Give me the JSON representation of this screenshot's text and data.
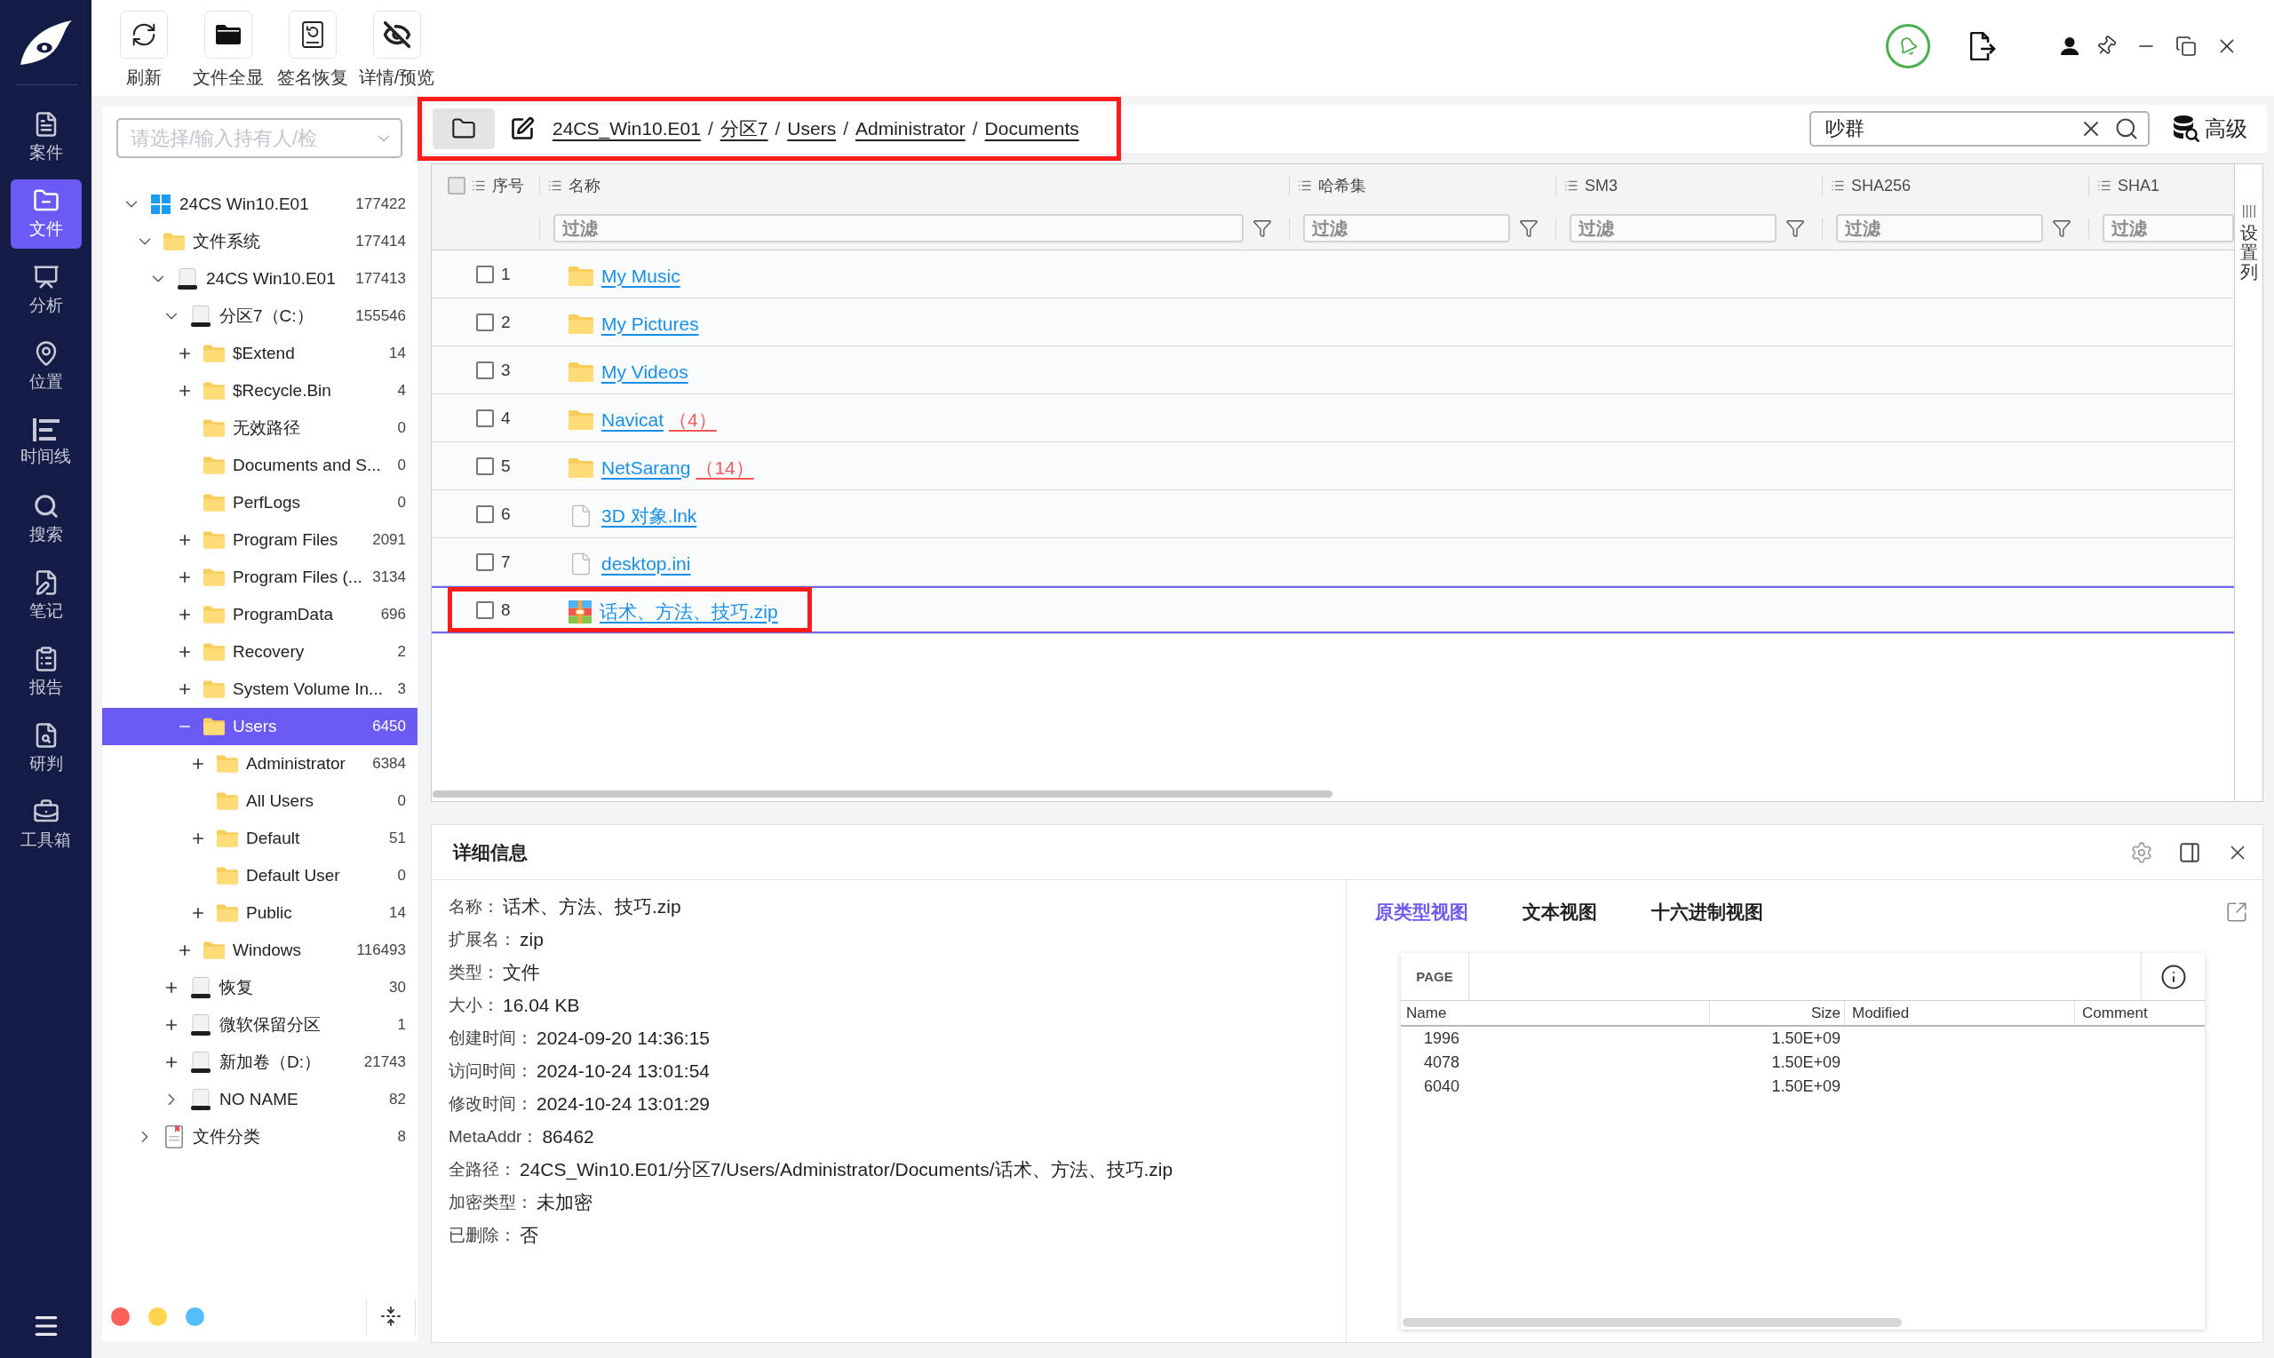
{
  "nav": {
    "items": [
      {
        "label": "案件",
        "selected": false
      },
      {
        "label": "文件",
        "selected": true
      },
      {
        "label": "分析",
        "selected": false
      },
      {
        "label": "位置",
        "selected": false
      },
      {
        "label": "时间线",
        "selected": false
      },
      {
        "label": "搜索",
        "selected": false
      },
      {
        "label": "笔记",
        "selected": false
      },
      {
        "label": "报告",
        "selected": false
      },
      {
        "label": "研判",
        "selected": false
      },
      {
        "label": "工具箱",
        "selected": false
      }
    ]
  },
  "toolbar": {
    "buttons": [
      {
        "label": "刷新"
      },
      {
        "label": "文件全显"
      },
      {
        "label": "签名恢复"
      },
      {
        "label": "详情/预览"
      }
    ]
  },
  "tree": {
    "owner_select": {
      "placeholder": "请选择/输入持有人/检"
    },
    "nodes": [
      {
        "label": "24CS Win10.E01",
        "count": "177422",
        "kind": "image",
        "toggle": {
          "kind": "chevron",
          "expanded": true
        },
        "selected": false,
        "children": [
          {
            "label": "文件系统",
            "count": "177414",
            "kind": "folder",
            "toggle": {
              "kind": "chevron",
              "expanded": true
            },
            "selected": false,
            "children": [
              {
                "label": "24CS Win10.E01",
                "count": "177413",
                "kind": "drive",
                "toggle": {
                  "kind": "chevron",
                  "expanded": true
                },
                "selected": false,
                "children": [
                  {
                    "label": "分区7（C:）",
                    "count": "155546",
                    "kind": "drive",
                    "toggle": {
                      "kind": "chevron",
                      "expanded": true
                    },
                    "selected": false,
                    "children": [
                      {
                        "label": "$Extend",
                        "count": "14",
                        "kind": "folder",
                        "toggle": {
                          "kind": "plus",
                          "expanded": false
                        },
                        "selected": false
                      },
                      {
                        "label": "$Recycle.Bin",
                        "count": "4",
                        "kind": "folder",
                        "toggle": {
                          "kind": "plus",
                          "expanded": false
                        },
                        "selected": false
                      },
                      {
                        "label": "无效路径",
                        "count": "0",
                        "kind": "folder",
                        "selected": false
                      },
                      {
                        "label": "Documents and S...",
                        "count": "0",
                        "kind": "folder",
                        "selected": false
                      },
                      {
                        "label": "PerfLogs",
                        "count": "0",
                        "kind": "folder",
                        "selected": false
                      },
                      {
                        "label": "Program Files",
                        "count": "2091",
                        "kind": "folder",
                        "toggle": {
                          "kind": "plus",
                          "expanded": false
                        },
                        "selected": false
                      },
                      {
                        "label": "Program Files (...",
                        "count": "3134",
                        "kind": "folder",
                        "toggle": {
                          "kind": "plus",
                          "expanded": false
                        },
                        "selected": false
                      },
                      {
                        "label": "ProgramData",
                        "count": "696",
                        "kind": "folder",
                        "toggle": {
                          "kind": "plus",
                          "expanded": false
                        },
                        "selected": false
                      },
                      {
                        "label": "Recovery",
                        "count": "2",
                        "kind": "folder",
                        "toggle": {
                          "kind": "plus",
                          "expanded": false
                        },
                        "selected": false
                      },
                      {
                        "label": "System Volume In...",
                        "count": "3",
                        "kind": "folder",
                        "toggle": {
                          "kind": "plus",
                          "expanded": false
                        },
                        "selected": false
                      },
                      {
                        "label": "Users",
                        "count": "6450",
                        "kind": "folder",
                        "toggle": {
                          "kind": "plus",
                          "expanded": true
                        },
                        "selected": true,
                        "children": [
                          {
                            "label": "Administrator",
                            "count": "6384",
                            "kind": "folder",
                            "toggle": {
                              "kind": "plus",
                              "expanded": false
                            },
                            "selected": false
                          },
                          {
                            "label": "All Users",
                            "count": "0",
                            "kind": "folder",
                            "selected": false
                          },
                          {
                            "label": "Default",
                            "count": "51",
                            "kind": "folder",
                            "toggle": {
                              "kind": "plus",
                              "expanded": false
                            },
                            "selected": false
                          },
                          {
                            "label": "Default User",
                            "count": "0",
                            "kind": "folder",
                            "selected": false
                          },
                          {
                            "label": "Public",
                            "count": "14",
                            "kind": "folder",
                            "toggle": {
                              "kind": "plus",
                              "expanded": false
                            },
                            "selected": false
                          }
                        ]
                      },
                      {
                        "label": "Windows",
                        "count": "116493",
                        "kind": "folder",
                        "toggle": {
                          "kind": "plus",
                          "expanded": false
                        },
                        "selected": false
                      }
                    ]
                  },
                  {
                    "label": "恢复",
                    "count": "30",
                    "kind": "drive",
                    "toggle": {
                      "kind": "plus",
                      "expanded": false
                    },
                    "selected": false
                  },
                  {
                    "label": "微软保留分区",
                    "count": "1",
                    "kind": "drive",
                    "toggle": {
                      "kind": "plus",
                      "expanded": false
                    },
                    "selected": false
                  },
                  {
                    "label": "新加卷（D:）",
                    "count": "21743",
                    "kind": "drive",
                    "toggle": {
                      "kind": "plus",
                      "expanded": false
                    },
                    "selected": false
                  },
                  {
                    "label": "NO NAME",
                    "count": "82",
                    "kind": "drive",
                    "toggle": {
                      "kind": "chevron",
                      "expanded": false
                    },
                    "selected": false
                  }
                ]
              }
            ]
          },
          {
            "label": "文件分类",
            "count": "8",
            "kind": "category",
            "toggle": {
              "kind": "chevron",
              "expanded": false
            },
            "selected": false
          }
        ]
      }
    ],
    "color_tags": [
      {
        "color": "#fa6157"
      },
      {
        "color": "#fdd54c"
      },
      {
        "color": "#55bdf7"
      }
    ]
  },
  "location_bar": {
    "highlighted": true,
    "separator": "/",
    "path": [
      "24CS_Win10.E01",
      "分区7",
      "Users",
      "Administrator",
      "Documents"
    ]
  },
  "search": {
    "value": "吵群"
  },
  "advanced_button": {
    "label": "高级"
  },
  "table": {
    "select_all": {
      "checked": false
    },
    "columns": [
      {
        "label": "序号"
      },
      {
        "label": "名称",
        "filter_placeholder": "过滤"
      },
      {
        "label": "哈希集",
        "filter_placeholder": "过滤"
      },
      {
        "label": "SM3",
        "filter_placeholder": "过滤"
      },
      {
        "label": "SHA256",
        "filter_placeholder": "过滤"
      },
      {
        "label": "SHA1",
        "filter_placeholder": "过滤"
      }
    ],
    "column_settings": {
      "label": "设置列"
    },
    "rows": [
      {
        "index": "1",
        "name": "My Music",
        "kind": "folder",
        "checked": false,
        "selected": false,
        "highlighted": false
      },
      {
        "index": "2",
        "name": "My Pictures",
        "kind": "folder",
        "checked": false,
        "selected": false,
        "highlighted": false
      },
      {
        "index": "3",
        "name": "My Videos",
        "kind": "folder",
        "checked": false,
        "selected": false,
        "highlighted": false
      },
      {
        "index": "4",
        "name": "Navicat",
        "count": "（4）",
        "kind": "folder",
        "checked": false,
        "selected": false,
        "highlighted": false
      },
      {
        "index": "5",
        "name": "NetSarang",
        "count": "（14）",
        "kind": "folder",
        "checked": false,
        "selected": false,
        "highlighted": false
      },
      {
        "index": "6",
        "name": "3D 对象.lnk",
        "kind": "file",
        "checked": false,
        "selected": false,
        "highlighted": false
      },
      {
        "index": "7",
        "name": "desktop.ini",
        "kind": "file",
        "checked": false,
        "selected": false,
        "highlighted": false
      },
      {
        "index": "8",
        "name": "话术、方法、技巧.zip",
        "kind": "archive",
        "checked": false,
        "selected": true,
        "highlighted": true
      }
    ]
  },
  "details": {
    "title": "详细信息",
    "fields": [
      {
        "label": "名称：",
        "value": "话术、方法、技巧.zip"
      },
      {
        "label": "扩展名：",
        "value": "zip"
      },
      {
        "label": "类型：",
        "value": "文件"
      },
      {
        "label": "大小：",
        "value": "16.04 KB"
      },
      {
        "label": "创建时间：",
        "value": "2024-09-20 14:36:15"
      },
      {
        "label": "访问时间：",
        "value": "2024-10-24 13:01:54"
      },
      {
        "label": "修改时间：",
        "value": "2024-10-24 13:01:29"
      },
      {
        "label": "MetaAddr：",
        "value": "86462"
      },
      {
        "label": "全路径：",
        "value": "24CS_Win10.E01/分区7/Users/Administrator/Documents/话术、方法、技巧.zip"
      },
      {
        "label": "加密类型：",
        "value": "未加密"
      },
      {
        "label": "已删除：",
        "value": "否"
      }
    ]
  },
  "preview": {
    "tabs": [
      {
        "label": "原类型视图",
        "selected": true
      },
      {
        "label": "文本视图",
        "selected": false
      },
      {
        "label": "十六进制视图",
        "selected": false
      }
    ],
    "page_tab": {
      "label": "PAGE"
    },
    "columns": [
      {
        "label": "Name"
      },
      {
        "label": "Size"
      },
      {
        "label": "Modified"
      },
      {
        "label": "Comment"
      }
    ],
    "rows": [
      {
        "name": "1996",
        "size": "1.50E+09"
      },
      {
        "name": "4078",
        "size": "1.50E+09"
      },
      {
        "name": "6040",
        "size": "1.50E+09"
      }
    ]
  }
}
